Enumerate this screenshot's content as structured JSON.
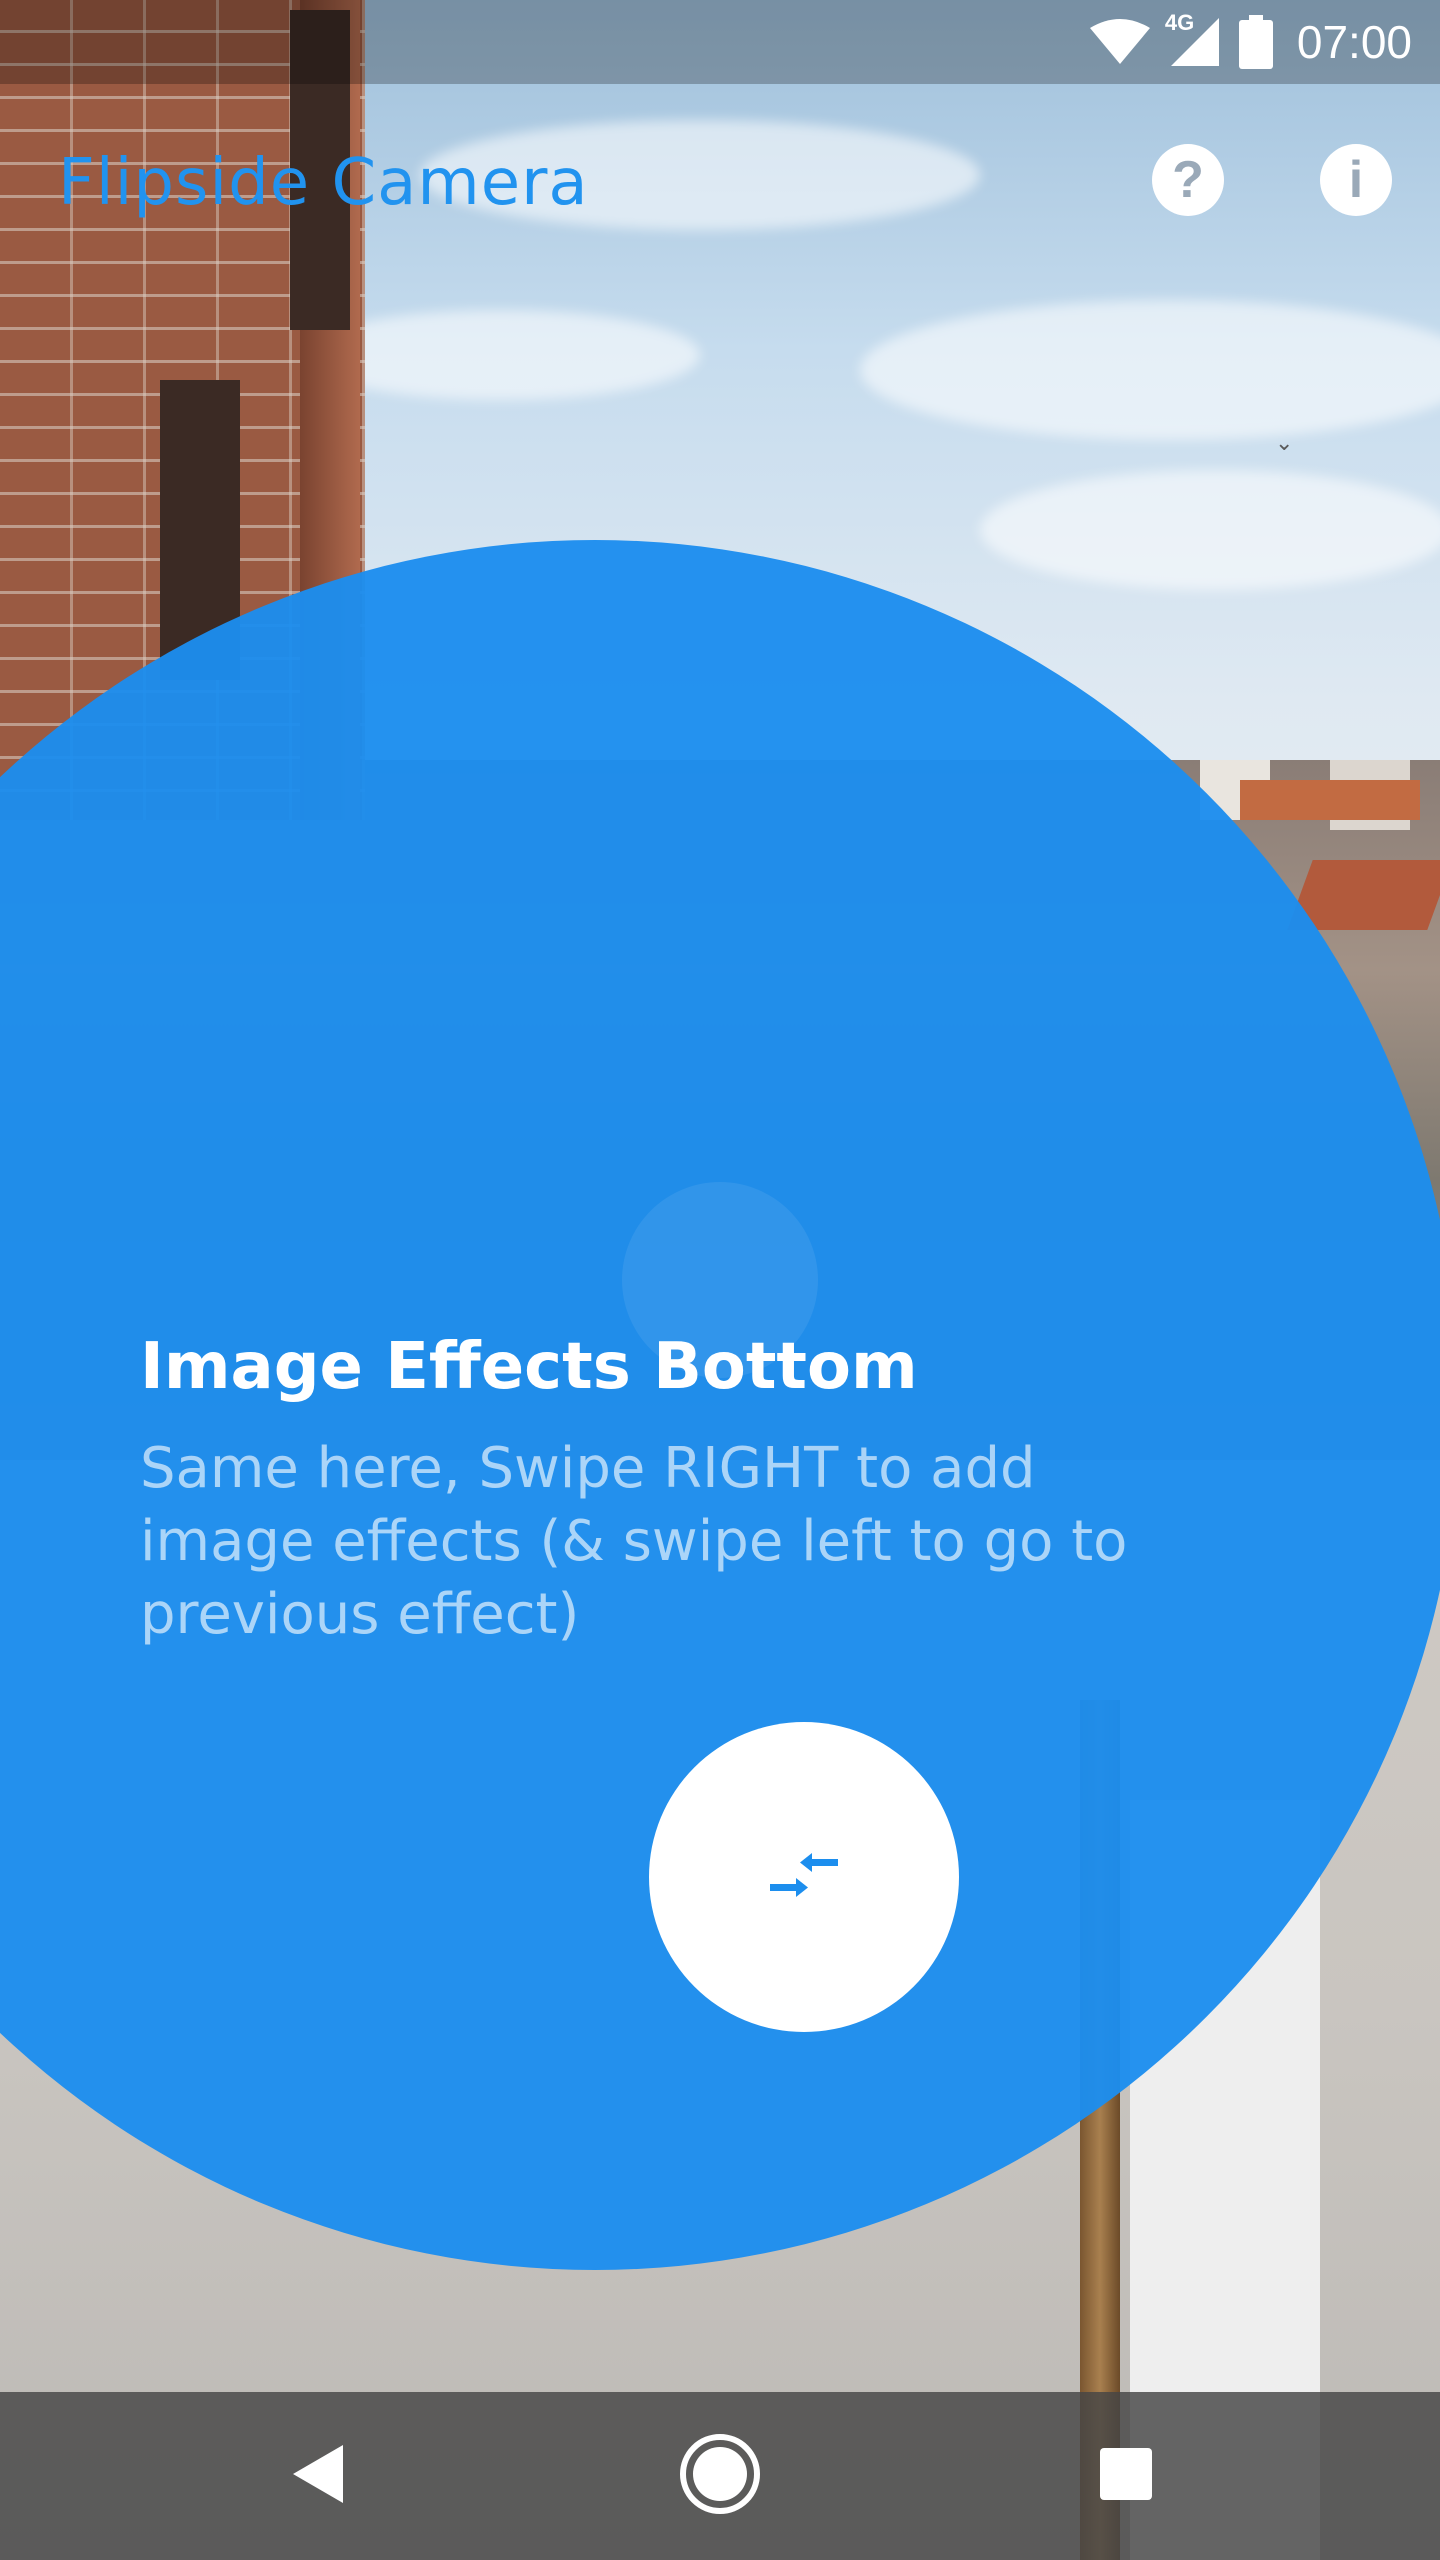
{
  "status_bar": {
    "wifi_icon": "wifi-icon",
    "network_label": "4G",
    "signal_icon": "cell-signal-icon",
    "battery_icon": "battery-icon",
    "time": "07:00"
  },
  "app_bar": {
    "title": "Flipside Camera",
    "title_color": "#2193ef",
    "help_icon": "help-icon",
    "help_glyph": "?",
    "info_icon": "info-icon",
    "info_glyph": "i"
  },
  "tutorial": {
    "title": "Image Effects Bottom",
    "description": "Same here, Swipe RIGHT to add image effects (& swipe left to go to previous effect)",
    "overlay_color": "#1c8eee",
    "target_icon": "swap-arrows-icon"
  },
  "nav_bar": {
    "back_icon": "back-triangle-icon",
    "home_icon": "home-circle-icon",
    "recents_icon": "recents-square-icon"
  }
}
